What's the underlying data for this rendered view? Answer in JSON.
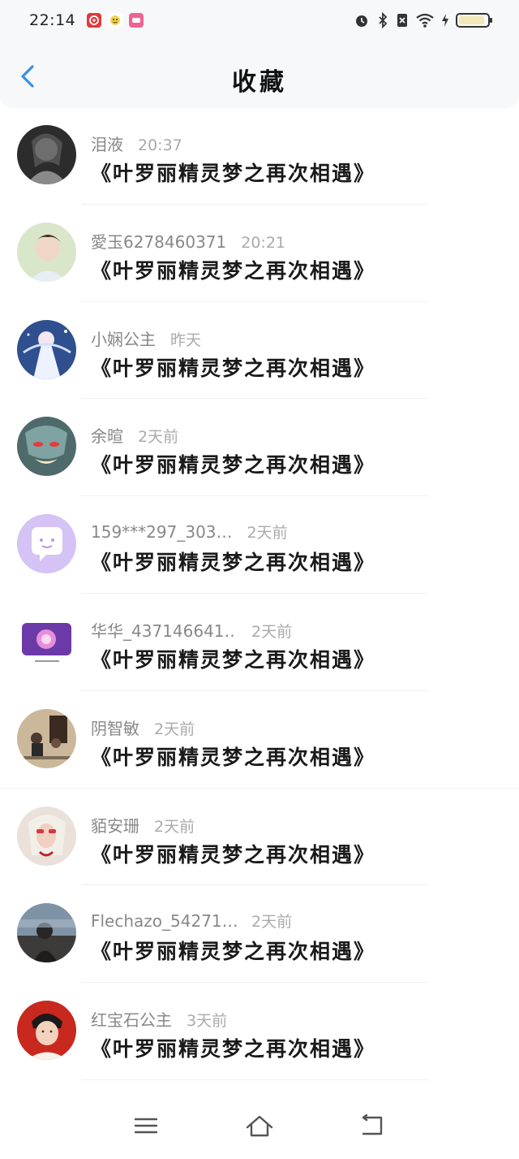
{
  "status_bar": {
    "time": "22:14",
    "apps": [
      {
        "icon": "netease-music-icon",
        "color": "#e4393c"
      },
      {
        "icon": "smile-app-icon",
        "color": "#f3d44a"
      },
      {
        "icon": "lofter-icon",
        "color": "#f06292"
      }
    ],
    "system_icons": [
      "alarm-icon",
      "bluetooth-icon",
      "no-sim-icon",
      "wifi-icon",
      "charging-icon",
      "battery-icon"
    ]
  },
  "header": {
    "title": "收藏",
    "accent": "#3a8ee6"
  },
  "items": [
    {
      "name": "泪液",
      "time": "20:37",
      "title": "《叶罗丽精灵梦之再次相遇》"
    },
    {
      "name": "愛玉6278460371",
      "time": "20:21",
      "title": "《叶罗丽精灵梦之再次相遇》"
    },
    {
      "name": "小娴公主",
      "time": "昨天",
      "title": "《叶罗丽精灵梦之再次相遇》"
    },
    {
      "name": "余暄",
      "time": "2天前",
      "title": "《叶罗丽精灵梦之再次相遇》"
    },
    {
      "name": "159***297_303…",
      "time": "2天前",
      "title": "《叶罗丽精灵梦之再次相遇》"
    },
    {
      "name": "华华_437146641…",
      "time": "2天前",
      "title": "《叶罗丽精灵梦之再次相遇》"
    },
    {
      "name": "阴智敏",
      "time": "2天前",
      "title": "《叶罗丽精灵梦之再次相遇》"
    },
    {
      "name": "貊安珊",
      "time": "2天前",
      "title": "《叶罗丽精灵梦之再次相遇》"
    },
    {
      "name": "Flechazo_54271…",
      "time": "2天前",
      "title": "《叶罗丽精灵梦之再次相遇》"
    },
    {
      "name": "红宝石公主",
      "time": "3天前",
      "title": "《叶罗丽精灵梦之再次相遇》"
    }
  ],
  "nav": [
    "menu-icon",
    "home-icon",
    "back-icon"
  ]
}
